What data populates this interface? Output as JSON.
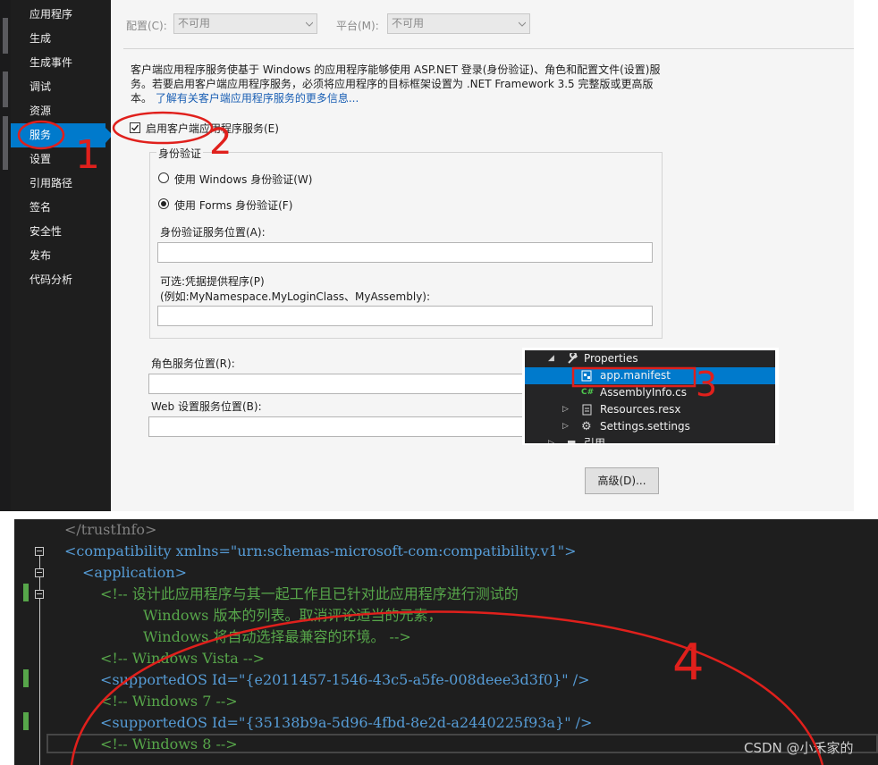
{
  "sidebar": {
    "items": [
      "应用程序",
      "生成",
      "生成事件",
      "调试",
      "资源",
      "服务",
      "设置",
      "引用路径",
      "签名",
      "安全性",
      "发布",
      "代码分析"
    ],
    "active_index": 5
  },
  "top_bar": {
    "config_label": "配置(C):",
    "config_value": "不可用",
    "platform_label": "平台(M):",
    "platform_value": "不可用"
  },
  "services": {
    "description": "客户端应用程序服务使基于 Windows 的应用程序能够使用 ASP.NET 登录(身份验证)、角色和配置文件(设置)服务。若要启用客户端应用程序服务，必须将应用程序的目标框架设置为 .NET Framework 3.5 完整版或更高版本。",
    "learn_more_link": "了解有关客户端应用程序服务的更多信息...",
    "enable_checkbox_label": "启用客户端应用程序服务(E)",
    "enable_checked": true,
    "auth_group_title": "身份验证",
    "radio_windows": "使用 Windows 身份验证(W)",
    "radio_forms": "使用 Forms 身份验证(F)",
    "selected_auth": "forms",
    "auth_service_location_label": "身份验证服务位置(A):",
    "auth_service_location_value": "",
    "optional_provider_label": "可选:凭据提供程序(P)",
    "optional_provider_example": "(例如:MyNamespace.MyLoginClass、MyAssembly):",
    "optional_provider_value": "",
    "role_service_location_label": "角色服务位置(R):",
    "web_settings_location_label": "Web 设置服务位置(B):",
    "advanced_button": "高级(D)..."
  },
  "solution_explorer": {
    "items": [
      {
        "label": "Properties",
        "icon": "wrench-icon",
        "expanded": true
      },
      {
        "label": "app.manifest",
        "icon": "manifest-icon",
        "selected": true
      },
      {
        "label": "AssemblyInfo.cs",
        "icon": "csharp-file-icon"
      },
      {
        "label": "Resources.resx",
        "icon": "resx-file-icon",
        "collapsed": true
      },
      {
        "label": "Settings.settings",
        "icon": "gear-icon",
        "collapsed": true
      },
      {
        "label": "引用",
        "icon": "references-icon",
        "collapsed": true
      }
    ]
  },
  "code": {
    "lines": [
      "</trustInfo>",
      "<compatibility xmlns=\"urn:schemas-microsoft-com:compatibility.v1\">",
      "<application>",
      "<!-- 设计此应用程序与其一起工作且已针对此应用程序进行测试的",
      "Windows 版本的列表。取消评论适当的元素，",
      "Windows 将自动选择最兼容的环境。 -->",
      "<!-- Windows Vista -->",
      "<supportedOS Id=\"{e2011457-1546-43c5-a5fe-008deee3d3f0}\" />",
      "<!-- Windows 7 -->",
      "<supportedOS Id=\"{35138b9a-5d96-4fbd-8e2d-a2440225f93a}\" />",
      "<!-- Windows 8 -->"
    ]
  },
  "annotations": [
    "1",
    "2",
    "3",
    "4"
  ],
  "watermark": "CSDN @小禾家的",
  "colors": {
    "accent": "#007acc",
    "annotation_red": "#e0201c",
    "comment_green": "#57a64a",
    "tag_blue": "#569cd6"
  }
}
